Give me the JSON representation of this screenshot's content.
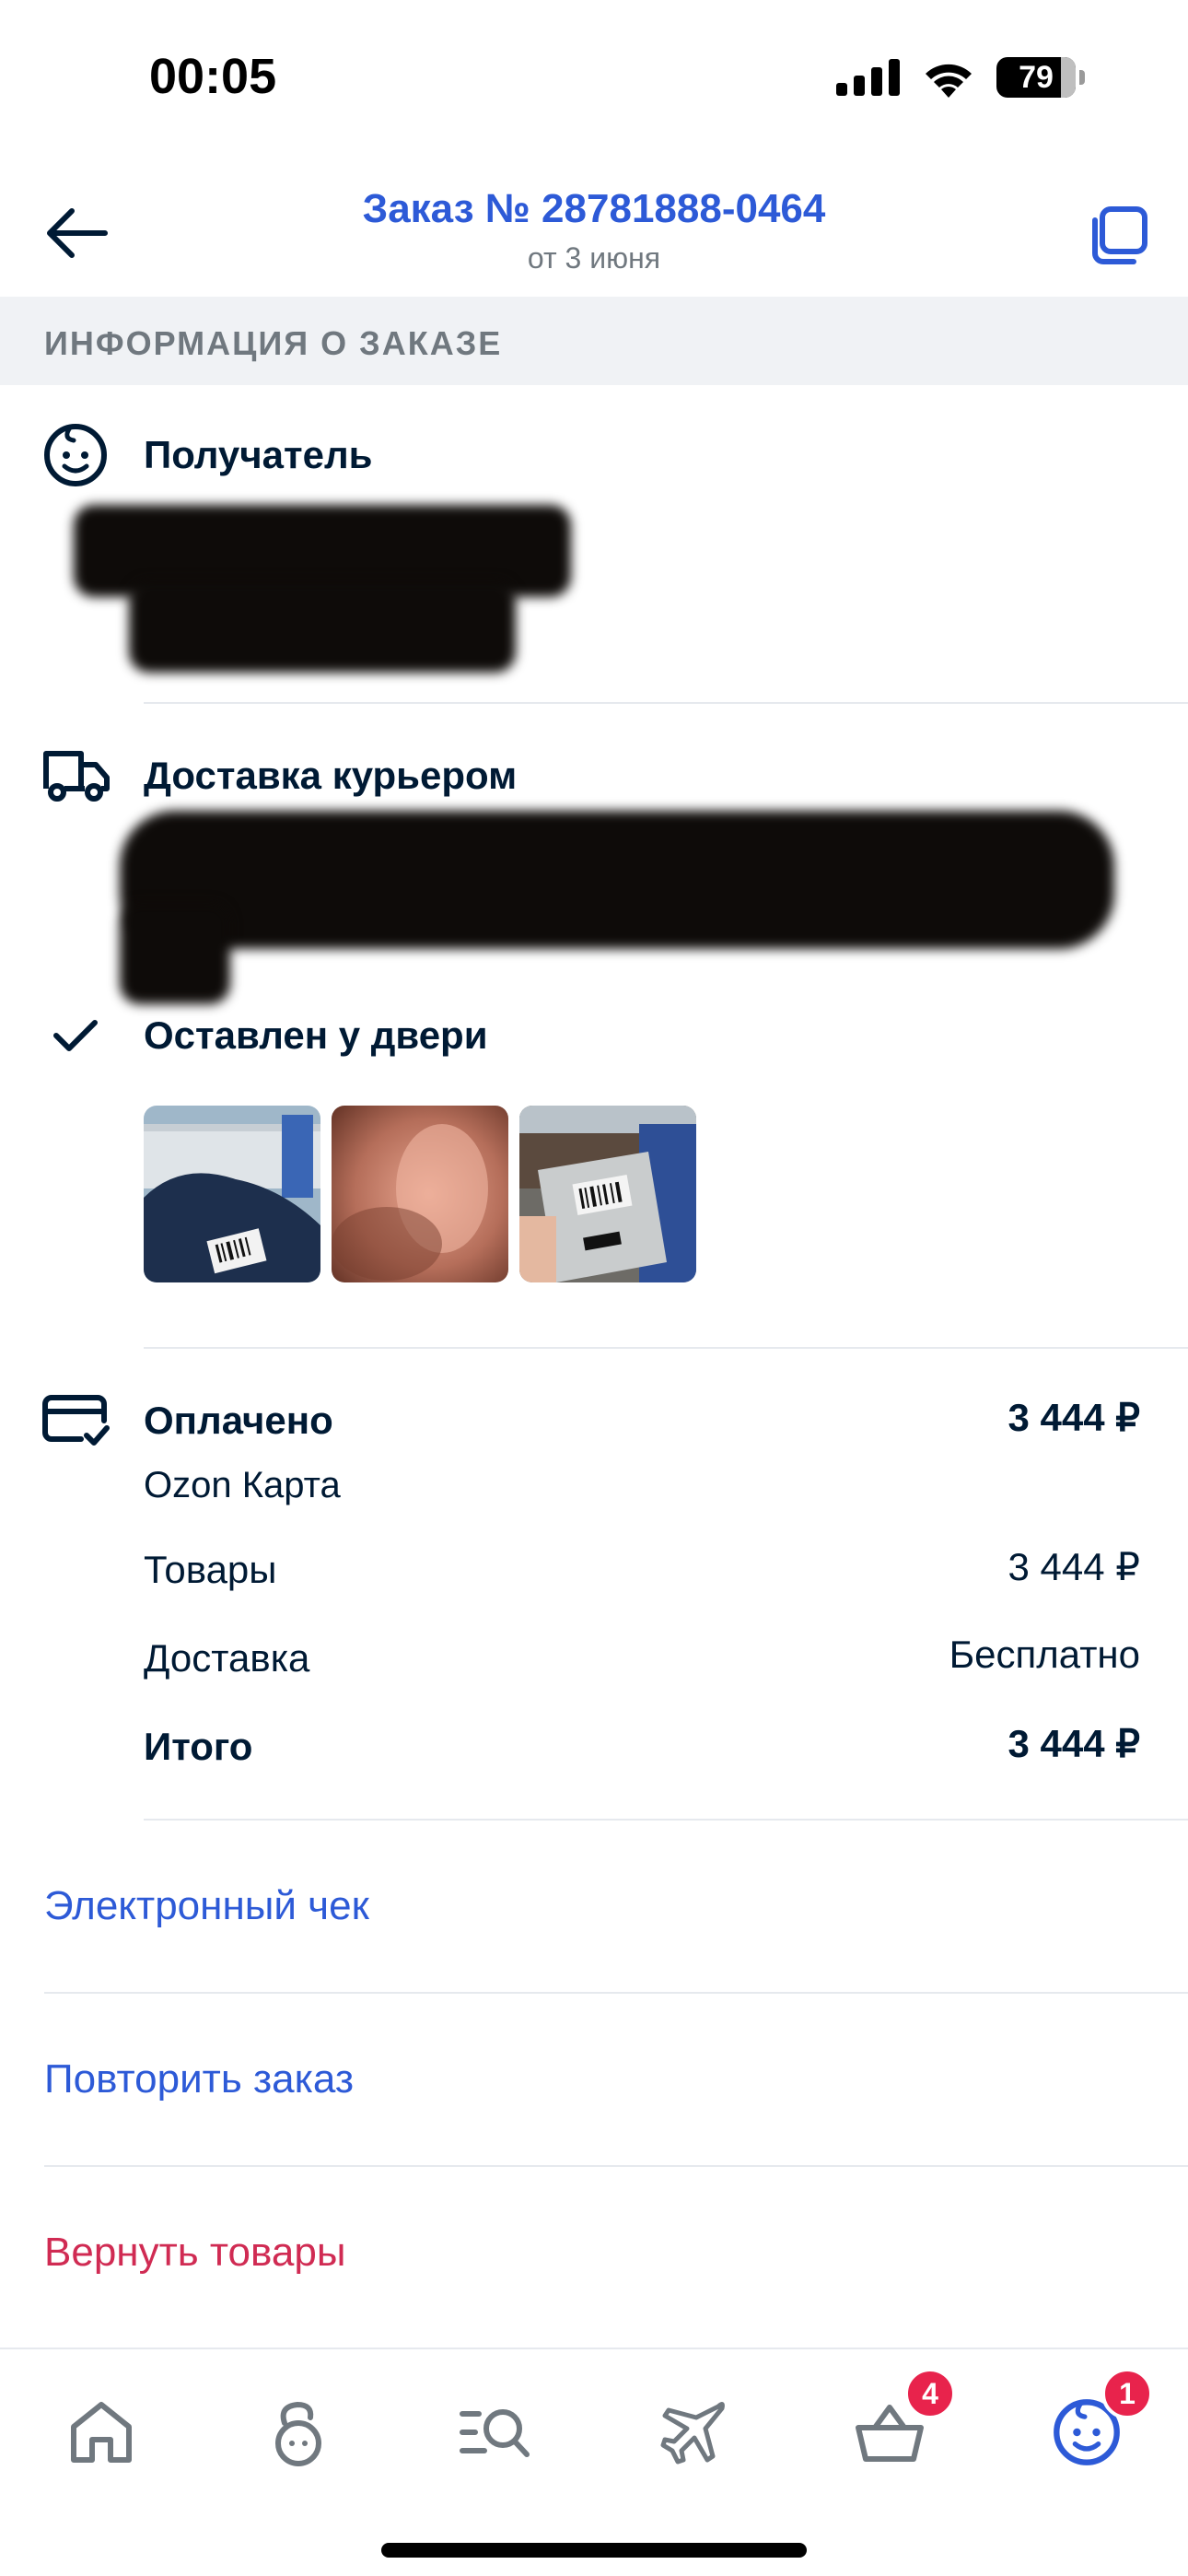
{
  "status_bar": {
    "time": "00:05",
    "battery": "79"
  },
  "header": {
    "title": "Заказ № 28781888-0464",
    "subtitle": "от 3 июня"
  },
  "section": {
    "label": "ИНФОРМАЦИЯ О ЗАКАЗЕ"
  },
  "recipient": {
    "title": "Получатель"
  },
  "delivery": {
    "title": "Доставка курьером"
  },
  "status": {
    "title": "Оставлен у двери",
    "photo_count": 3
  },
  "payment": {
    "title": "Оплачено",
    "amount": "3 444 ₽",
    "method": "Ozon Карта",
    "rows": [
      {
        "label": "Товары",
        "value": "3 444 ₽"
      },
      {
        "label": "Доставка",
        "value": "Бесплатно"
      },
      {
        "label": "Итого",
        "value": "3 444 ₽"
      }
    ]
  },
  "actions": {
    "receipt": "Электронный чек",
    "repeat": "Повторить заказ",
    "return": "Вернуть товары"
  },
  "tab_bar": {
    "tabs": [
      {
        "icon": "home-icon"
      },
      {
        "icon": "fresh-icon"
      },
      {
        "icon": "catalog-search-icon"
      },
      {
        "icon": "travel-plane-icon"
      },
      {
        "icon": "cart-icon",
        "badge": "4"
      },
      {
        "icon": "profile-icon",
        "badge": "1"
      }
    ]
  },
  "colors": {
    "accent": "#2d5ad7",
    "danger": "#d02b53",
    "badge": "#e8234c",
    "text": "#001a34"
  }
}
